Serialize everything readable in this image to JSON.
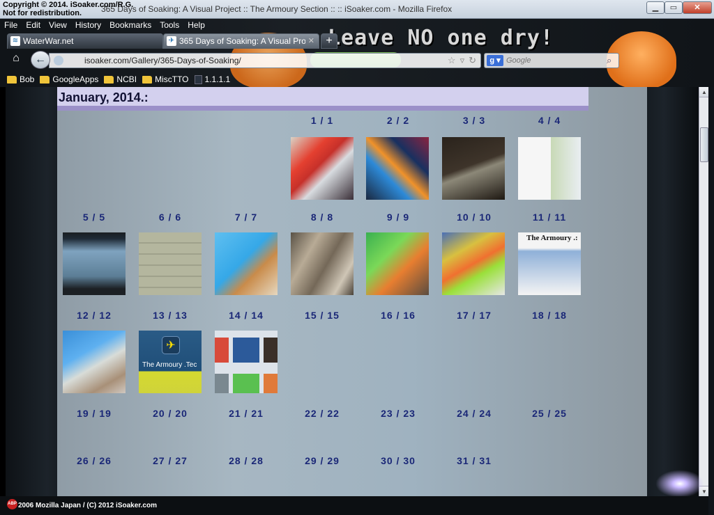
{
  "window": {
    "copyright": "Copyright © 2014. iSoaker.com/R.G.",
    "redistribution": "Not for redistribution.",
    "title": "365 Days of Soaking: A Visual Project :: The Armoury Section :: :: iSoaker.com - Mozilla Firefox"
  },
  "menu": [
    "File",
    "Edit",
    "View",
    "History",
    "Bookmarks",
    "Tools",
    "Help"
  ],
  "tabs": [
    {
      "label": "WaterWar.net",
      "active": false
    },
    {
      "label": "365 Days of Soaking: A Visual Project ...",
      "active": true
    }
  ],
  "nav": {
    "url": "isoaker.com/Gallery/365-Days-of-Soaking/",
    "search_placeholder": "Google"
  },
  "persona": {
    "banner": "Leave NO one dry!"
  },
  "bookmarks": [
    {
      "label": "Bob",
      "type": "folder"
    },
    {
      "label": "GoogleApps",
      "type": "folder"
    },
    {
      "label": "NCBI",
      "type": "folder"
    },
    {
      "label": "MiscTTO",
      "type": "folder"
    },
    {
      "label": "1.1.1.1",
      "type": "page"
    }
  ],
  "page": {
    "month_title": "January, 2014.:",
    "days": [
      "1 / 1",
      "2 / 2",
      "3 / 3",
      "4 / 4",
      "5 / 5",
      "6 / 6",
      "7 / 7",
      "8 / 8",
      "9 / 9",
      "10 / 10",
      "11 / 11",
      "12 / 12",
      "13 / 13",
      "14 / 14",
      "15 / 15",
      "16 / 16",
      "17 / 17",
      "18 / 18",
      "19 / 19",
      "20 / 20",
      "21 / 21",
      "22 / 22",
      "23 / 23",
      "24 / 24",
      "25 / 25",
      "26 / 26",
      "27 / 27",
      "28 / 28",
      "29 / 29",
      "30 / 30",
      "31 / 31"
    ],
    "thumb_text": {
      "armoury_page": "The Armoury .:",
      "armoury_tile": "The Armoury .Tec"
    }
  },
  "status": {
    "text": "2006 Mozilla Japan / (C) 2012 iSoaker.com"
  }
}
